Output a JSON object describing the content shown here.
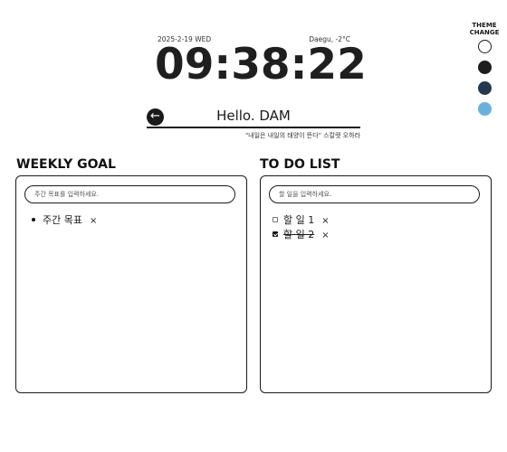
{
  "header": {
    "date": "2025-2-19 WED",
    "weather": "Daegu, -2°C",
    "time": "09:38:22",
    "greeting": "Hello. DAM",
    "quote": "\"내일은 내일의 태양이 뜬다\" 스칼렛 오하라"
  },
  "theme": {
    "title_line1": "THEME",
    "title_line2": "CHANGE",
    "swatches": [
      "#ffffff",
      "#1d1d1d",
      "#24384f",
      "#6ab0dd"
    ]
  },
  "weekly_goal": {
    "title": "WEEKLY GOAL",
    "placeholder": "주간 목표를 입력하세요.",
    "items": [
      {
        "text": "주간 목표",
        "delete": "×"
      }
    ]
  },
  "todo": {
    "title": "TO DO LIST",
    "placeholder": "할 일을 입력하세요.",
    "items": [
      {
        "text": "할 일 1",
        "done": false,
        "delete": "×"
      },
      {
        "text": "할 일 2",
        "done": true,
        "delete": "×"
      }
    ]
  }
}
